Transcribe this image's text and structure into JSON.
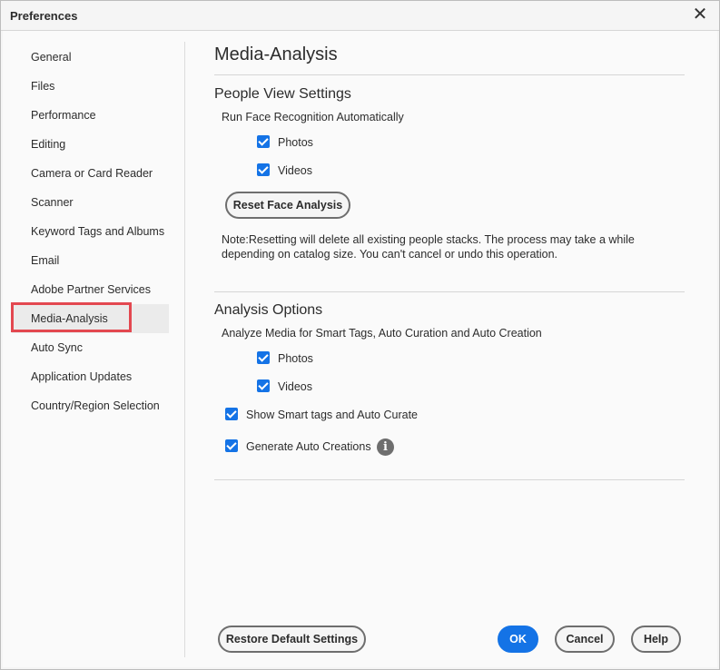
{
  "window": {
    "title": "Preferences"
  },
  "sidebar": {
    "items": [
      {
        "label": "General"
      },
      {
        "label": "Files"
      },
      {
        "label": "Performance"
      },
      {
        "label": "Editing"
      },
      {
        "label": "Camera or Card Reader"
      },
      {
        "label": "Scanner"
      },
      {
        "label": "Keyword Tags and Albums"
      },
      {
        "label": "Email"
      },
      {
        "label": "Adobe Partner Services"
      },
      {
        "label": "Media-Analysis",
        "selected": true
      },
      {
        "label": "Auto Sync"
      },
      {
        "label": "Application Updates"
      },
      {
        "label": "Country/Region Selection"
      }
    ]
  },
  "main": {
    "title": "Media-Analysis",
    "people_view": {
      "heading": "People View Settings",
      "run_label": "Run Face Recognition Automatically",
      "photos_label": "Photos",
      "photos_checked": true,
      "videos_label": "Videos",
      "videos_checked": true,
      "reset_button": "Reset Face Analysis",
      "note": "Note:Resetting will delete all existing people stacks. The process may take a while depending on catalog size. You can't cancel or undo this operation."
    },
    "analysis_options": {
      "heading": "Analysis Options",
      "analyze_label": "Analyze Media for Smart Tags, Auto Curation and Auto Creation",
      "photos_label": "Photos",
      "photos_checked": true,
      "videos_label": "Videos",
      "videos_checked": true,
      "smart_tags_label": "Show Smart tags and Auto Curate",
      "smart_tags_checked": true,
      "auto_creations_label": "Generate Auto Creations",
      "auto_creations_checked": true,
      "info_icon": "info-icon"
    }
  },
  "footer": {
    "restore_button": "Restore Default Settings",
    "ok_button": "OK",
    "cancel_button": "Cancel",
    "help_button": "Help"
  },
  "colors": {
    "accent": "#1473e6",
    "highlight": "#e34850"
  }
}
